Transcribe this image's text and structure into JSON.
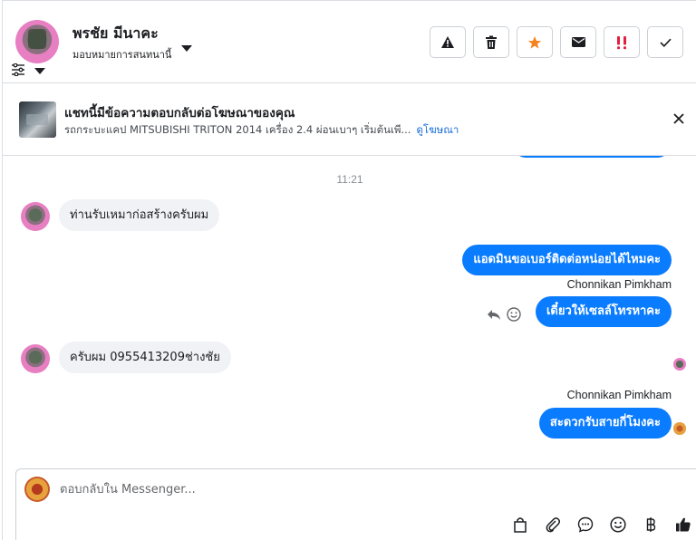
{
  "header": {
    "contact_name": "พรชัย มีนาคะ",
    "assign_label": "มอบหมายการสนทนานี้",
    "actions": [
      {
        "name": "report-button",
        "icon": "warning-icon"
      },
      {
        "name": "delete-button",
        "icon": "trash-icon"
      },
      {
        "name": "star-button",
        "icon": "star-icon"
      },
      {
        "name": "mark-unread-button",
        "icon": "envelope-icon"
      },
      {
        "name": "follow-up-button",
        "icon": "double-exclamation-icon"
      },
      {
        "name": "mark-done-button",
        "icon": "check-icon"
      }
    ]
  },
  "ad": {
    "title": "แชทนี้มีข้อความตอบกลับต่อโฆษณาของคุณ",
    "subtitle": "รถกระบะแคป MITSUBISHI TRITON 2014 เครื่อง 2.4 ผ่อนเบาๆ เริ่มต้นเพี...",
    "link": "ดูโฆษณา"
  },
  "chat": {
    "timestamp": "11:21",
    "messages": [
      {
        "direction": "in",
        "text": "ท่านรับเหมาก่อสร้างครับผม"
      },
      {
        "direction": "out",
        "text": "แอดมินขอเบอร์ติดต่อหน่อยได้ไหมคะ"
      },
      {
        "direction": "out",
        "sender": "Chonnikan Pimkham",
        "text": "เดี๋ยวให้เซลล์โทรหาคะ"
      },
      {
        "direction": "in",
        "text": "ครับผม  0955413209ช่างชัย"
      },
      {
        "direction": "out",
        "sender": "Chonnikan Pimkham",
        "text": "สะดวกรับสายกี่โมงคะ"
      }
    ]
  },
  "composer": {
    "placeholder": "ตอบกลับใน Messenger..."
  },
  "colors": {
    "accent": "#0a7cff",
    "incoming_bubble": "#f0f2f5",
    "star": "#f5821f",
    "alert": "#e41e3f",
    "link": "#1a6ed8"
  }
}
